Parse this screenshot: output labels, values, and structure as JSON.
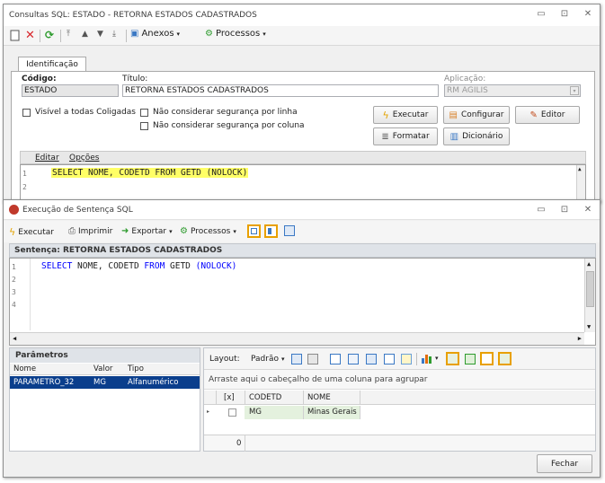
{
  "back_window": {
    "title": "Consultas SQL: ESTADO - RETORNA ESTADOS CADASTRADOS",
    "toolbar": {
      "anexos": "Anexos",
      "processos": "Processos"
    },
    "tab": "Identificação",
    "codigo_label": "Código:",
    "codigo_value": "ESTADO",
    "titulo_label": "Título:",
    "titulo_value": "RETORNA ESTADOS CADASTRADOS",
    "aplicacao_label": "Aplicação:",
    "aplicacao_value": "RM AGILIS",
    "chk_coligadas": "Visível a todas Coligadas",
    "chk_seg_linha": "Não considerar segurança por linha",
    "chk_seg_coluna": "Não considerar segurança por coluna",
    "btn_executar": "Executar",
    "btn_configurar": "Configurar",
    "btn_editor": "Editor",
    "btn_formatar": "Formatar",
    "btn_dicionario": "Dicionário",
    "menu_editar": "Editar",
    "menu_opcoes": "Opções",
    "code_line1": "SELECT NOME, CODETD FROM GETD (NOLOCK)",
    "line_numbers": [
      "1",
      "2"
    ]
  },
  "front_window": {
    "title": "Execução de Sentença SQL",
    "toolbar": {
      "executar": "Executar",
      "imprimir": "Imprimir",
      "exportar": "Exportar",
      "processos": "Processos"
    },
    "sentence_header": "Sentença: RETORNA ESTADOS CADASTRADOS",
    "code": {
      "select": "SELECT",
      "cols": " NOME, CODETD ",
      "from": "FROM",
      "table": " GETD ",
      "nolock": "(NOLOCK)"
    },
    "line_numbers": [
      "1",
      "2",
      "3",
      "4"
    ],
    "params": {
      "title": "Parâmetros",
      "headers": [
        "Nome",
        "Valor",
        "Tipo"
      ],
      "row": {
        "nome": "PARAMETRO_32",
        "valor": "MG",
        "tipo": "Alfanumérico"
      }
    },
    "results": {
      "layout_label": "Layout:",
      "padrao_label": "Padrão",
      "group_hint": "Arraste aqui o cabeçalho de uma coluna para agrupar",
      "headers": [
        "[x]",
        "CODETD",
        "NOME"
      ],
      "row": {
        "codetd": "MG",
        "nome": "Minas Gerais"
      },
      "footer_count": "0"
    },
    "btn_fechar": "Fechar"
  },
  "colors": {
    "highlight": "#ffff66",
    "selection": "#0a3e8c",
    "keyword": "#0000ff",
    "toggle_border": "#e8a000"
  }
}
